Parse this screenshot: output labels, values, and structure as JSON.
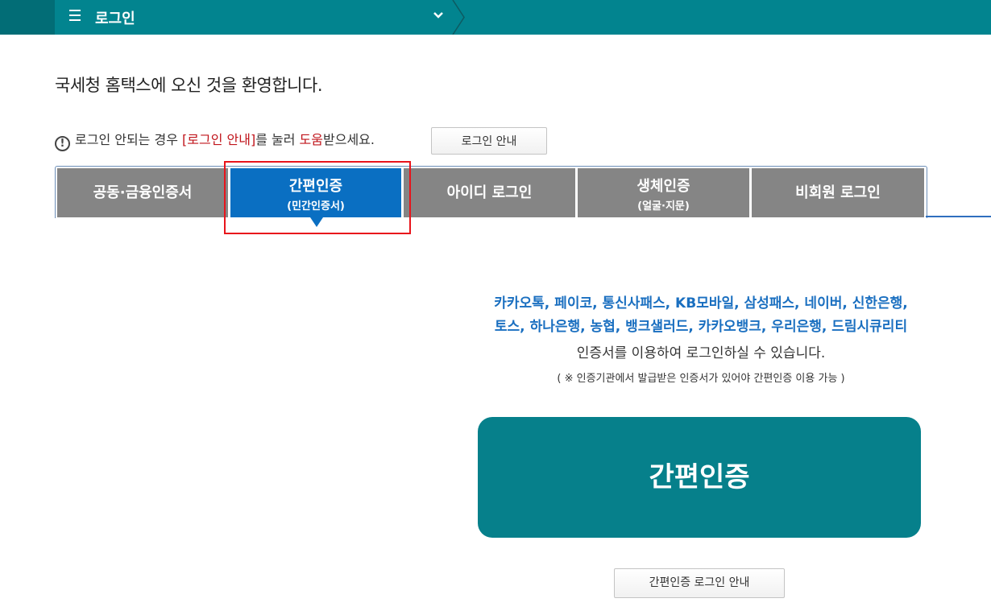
{
  "topbar": {
    "menu_icon": "hamburger-menu-icon",
    "menu_label": "로그인",
    "dropdown_icon": "chevron-down-icon",
    "color": "#02848f"
  },
  "welcome": "국세청 홈택스에 오신 것을 환영합니다.",
  "notice": {
    "icon": "exclamation-circle-icon",
    "part1": "로그인 안되는 경우 ",
    "link": "[로그인 안내]",
    "part2": "를 눌러 ",
    "help": "도움",
    "part3": "받으세요.",
    "button": "로그인 안내"
  },
  "tabs": [
    {
      "label": "공동·금융인증서",
      "sub": ""
    },
    {
      "label": "간편인증",
      "sub": "(민간인증서)"
    },
    {
      "label": "아이디 로그인",
      "sub": ""
    },
    {
      "label": "생체인증",
      "sub": "(얼굴·지문)"
    },
    {
      "label": "비회원 로그인",
      "sub": ""
    }
  ],
  "active_tab": "간편인증",
  "content": {
    "providers_line1": "카카오톡, 페이코, 통신사패스, KB모바일, 삼성패스, 네이버, 신한은행,",
    "providers_line2": "토스, 하나은행, 농협, 뱅크샐러드, 카카오뱅크, 우리은행, 드림시큐리티",
    "description": "인증서를 이용하여 로그인하실 수 있습니다.",
    "note": "( ※ 인증기관에서 발급받은 인증서가 있어야 간편인증 이용 가능 )",
    "main_button": "간편인증",
    "guide_button": "간편인증 로그인 안내"
  },
  "colors": {
    "teal": "#06808b",
    "active_tab": "#0a6fc2",
    "inactive_tab": "#858585",
    "provider_text": "#1a6fc0",
    "highlight": "#e8141b"
  }
}
